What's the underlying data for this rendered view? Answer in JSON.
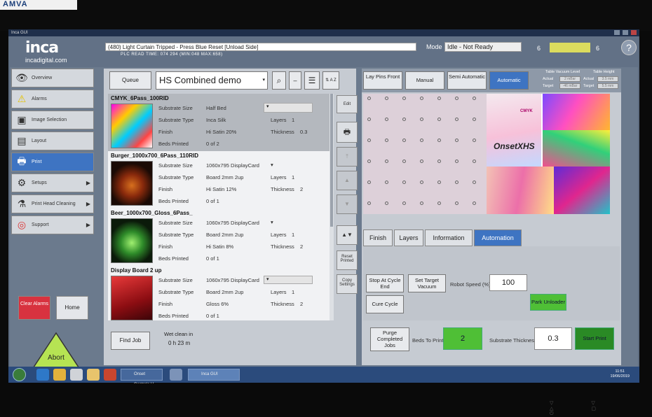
{
  "bezel": {
    "brand": "AMVA"
  },
  "window": {
    "title": "Inca GUI"
  },
  "header": {
    "logo_big": "inca",
    "logo_small": "incadigital.com",
    "message": "(480) Light Curtain Tripped - Press Blue Reset [Unload Side]",
    "plc": "PLC READ TIME: 074 294 (MIN:048 MAX:658)",
    "mode_label": "Mode",
    "mode_value": "Idle - Not Ready",
    "count_left": "6",
    "count_right": "6",
    "help": "?"
  },
  "sidebar": {
    "items": [
      {
        "label": "Overview",
        "icon": "eye-icon"
      },
      {
        "label": "Alarms",
        "icon": "warning-icon"
      },
      {
        "label": "Image Selection",
        "icon": "image-icon"
      },
      {
        "label": "Layout",
        "icon": "layout-icon"
      },
      {
        "label": "Print",
        "icon": "printer-icon"
      },
      {
        "label": "Setups",
        "icon": "gear-icon"
      },
      {
        "label": "Print Head Cleaning",
        "icon": "spray-icon"
      },
      {
        "label": "Support",
        "icon": "lifebuoy-icon"
      }
    ],
    "clear_alarms": "Clear Alarms",
    "home": "Home",
    "abort": "Abort"
  },
  "queue": {
    "queue_button": "Queue",
    "combo_value": "HS Combined demo",
    "sort_label": "A Z",
    "jobs": [
      {
        "title": "CMYK_6Pass_100RID",
        "size": "Half Bed",
        "type": "Inca Silk",
        "finish": "Hi Satin 20%",
        "beds": "0  of  2",
        "layers": "1",
        "thickness": "0.3"
      },
      {
        "title": "Burger_1000x700_6Pass_110RID",
        "size": "1060x795 DisplayCard",
        "type": "Board 2mm 2up",
        "finish": "Hi Satin 12%",
        "beds": "0  of  1",
        "layers": "1",
        "thickness": "2"
      },
      {
        "title": "Beer_1000x700_Gloss_6Pass_",
        "size": "1060x795 DisplayCard",
        "type": "Board 2mm 2up",
        "finish": "Hi Satin 8%",
        "beds": "0  of  1",
        "layers": "1",
        "thickness": "2"
      },
      {
        "title": "Display Board 2 up",
        "size": "1060x795 DisplayCard",
        "type": "Board 2mm 2up",
        "finish": "Gloss 6%",
        "beds": "0  of  1",
        "layers": "1",
        "thickness": "2"
      }
    ],
    "labels": {
      "substrate_size": "Substrate Size",
      "substrate_type": "Substrate Type",
      "finish": "Finish",
      "beds_printed": "Beds Printed",
      "layers": "Layers",
      "thickness": "Thickness"
    },
    "find_job": "Find Job",
    "wet_label": "Wet clean in",
    "wet_value": "0   h  23  m"
  },
  "midcol": {
    "edit": "Edit",
    "reset_printed": "Reset Printed",
    "copy_settings": "Copy Settings"
  },
  "right": {
    "lay_pins": "Lay Pins Front",
    "manual": "Manual",
    "semi": "Semi Automatic",
    "automatic": "Automatic",
    "vacuum_title": "Table Vacuum Level",
    "height_title": "Table Height",
    "actual": "Actual",
    "target": "Target",
    "vac_actual": "2 mBar",
    "vac_target": "-46 mBar",
    "h_actual": "3.5 mm",
    "h_target": "5.5 mm",
    "art_text": "OnsetXHS",
    "art_small": "CMYK",
    "tabs": [
      "Finish",
      "Layers",
      "Information",
      "Automation"
    ],
    "stop_cycle": "Stop At Cycle End",
    "set_vacuum": "Set Target Vacuum",
    "robot_speed_label": "Robot Speed (%)",
    "robot_speed": "100",
    "cure_cycle": "Cure Cycle",
    "park_unloader": "Park Unloader",
    "purge": "Purge Completed Jobs",
    "beds_to_print_label": "Beds To Print",
    "beds_to_print": "2",
    "thickness_label": "Substrate Thickness",
    "thickness": "0.3",
    "start_print": "Start Print"
  },
  "taskbar": {
    "task1": "Onset Controls U...",
    "task2": "Inca GUI",
    "time": "11:51",
    "date": "19/06/2019"
  }
}
